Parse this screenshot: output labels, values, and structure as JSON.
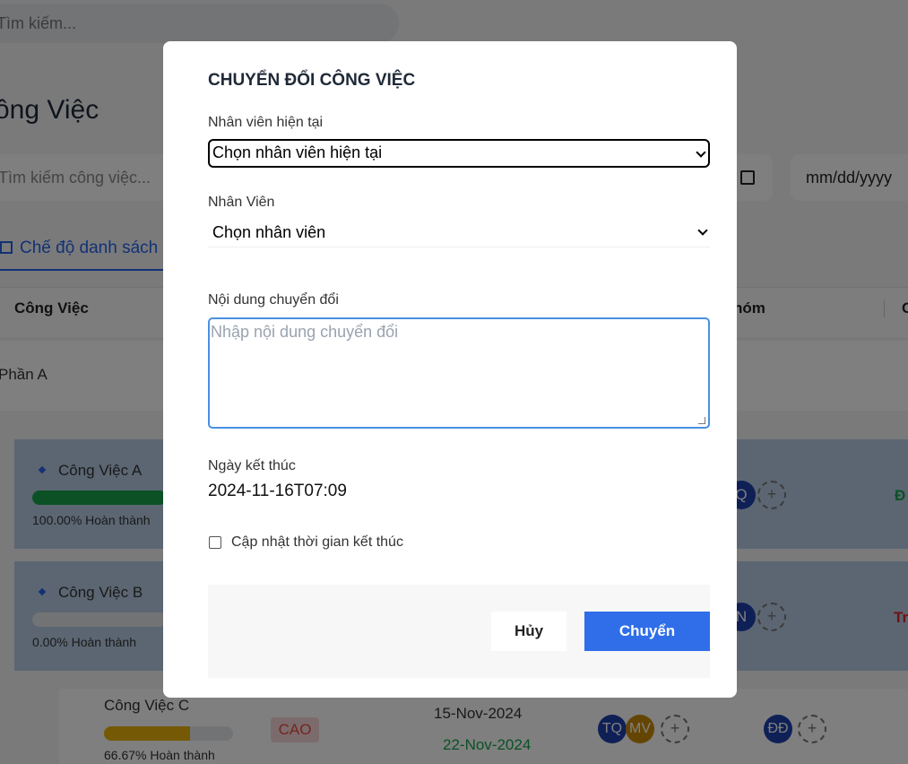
{
  "background": {
    "top_search_placeholder": "Tìm kiếm...",
    "page_title": "ông Việc",
    "task_search_placeholder": "Tìm kiếm công việc...",
    "date_placeholder": "mm/dd/yyyy",
    "view_mode_tab": "Chế độ danh sách",
    "columns": {
      "task": "Công Việc",
      "group": "hóm",
      "last": "C"
    },
    "section": "Phần A",
    "tasks": [
      {
        "name": "Công Việc A",
        "progress_label": "100.00% Hoàn thành",
        "progress": 1.0,
        "bar_color": "#16a34a",
        "avatar": "Q",
        "avatar_color": "#1e40af",
        "status": "Đ",
        "status_color": "#16a34a"
      },
      {
        "name": "Công Việc B",
        "progress_label": "0.00% Hoàn thành",
        "progress": 0.0,
        "bar_color": "#16a34a",
        "avatar": "N",
        "avatar_color": "#1e40af",
        "status": "Tr",
        "status_color": "#dc2626"
      },
      {
        "name": "Công Việc C",
        "progress_label": "66.67% Hoàn thành",
        "progress": 0.6667,
        "bar_color": "#eab308",
        "priority": "CAO",
        "start_date": "15-Nov-2024",
        "end_date": "22-Nov-2024",
        "avatars": [
          "TQ",
          "MV"
        ],
        "avatar_colors": [
          "#1e40af",
          "#ca8a04"
        ],
        "group_avatar": "ĐĐ"
      }
    ],
    "add_symbol": "+"
  },
  "modal": {
    "title": "CHUYỂN ĐỔI CÔNG VIỆC",
    "current_employee_label": "Nhân viên hiện tại",
    "current_employee_value": "Chọn nhân viên hiện tại",
    "employee_label": "Nhân Viên",
    "employee_value": "Chọn nhân viên",
    "content_label": "Nội dung chuyển đổi",
    "content_placeholder": "Nhập nội dung chuyển đổi",
    "end_date_label": "Ngày kết thúc",
    "end_date_value": "2024-11-16T07:09",
    "update_end_time_label": "Cập nhật thời gian kết thúc",
    "update_end_time_checked": false,
    "cancel_label": "Hủy",
    "submit_label": "Chuyển"
  },
  "colors": {
    "accent": "#2f6ee8",
    "overlay": "rgba(0,0,0,0.5)"
  }
}
